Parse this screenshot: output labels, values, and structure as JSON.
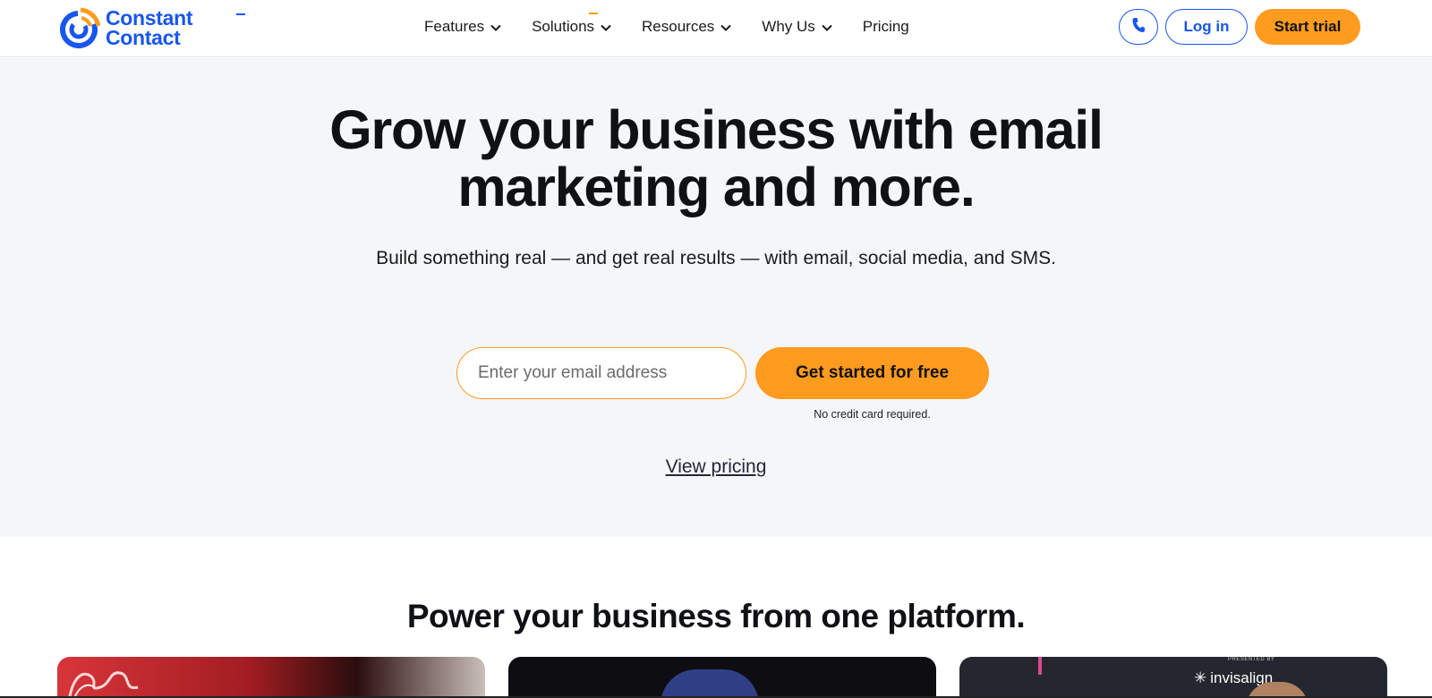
{
  "header": {
    "logo_line1": "Constant",
    "logo_line2": "Contact",
    "nav": [
      {
        "label": "Features",
        "has_dropdown": true
      },
      {
        "label": "Solutions",
        "has_dropdown": true
      },
      {
        "label": "Resources",
        "has_dropdown": true
      },
      {
        "label": "Why Us",
        "has_dropdown": true
      },
      {
        "label": "Pricing",
        "has_dropdown": false
      }
    ],
    "phone_icon": "phone-icon",
    "login_label": "Log in",
    "trial_label": "Start trial"
  },
  "hero": {
    "title_line1": "Grow your business with email",
    "title_line2": "marketing and more.",
    "subtitle": "Build something real — and get real results — with email, social media, and SMS.",
    "email_placeholder": "Enter your email address",
    "email_value": "",
    "cta_label": "Get started for free",
    "no_credit_card": "No credit card required.",
    "view_pricing": "View pricing"
  },
  "platform": {
    "title": "Power your business from one platform.",
    "card3_presented": "PRESENTED BY",
    "card3_label": "invisalign"
  },
  "colors": {
    "brand_blue": "#1856ed",
    "accent_orange": "#ff9b1e",
    "hero_bg": "#f5f6fa"
  }
}
